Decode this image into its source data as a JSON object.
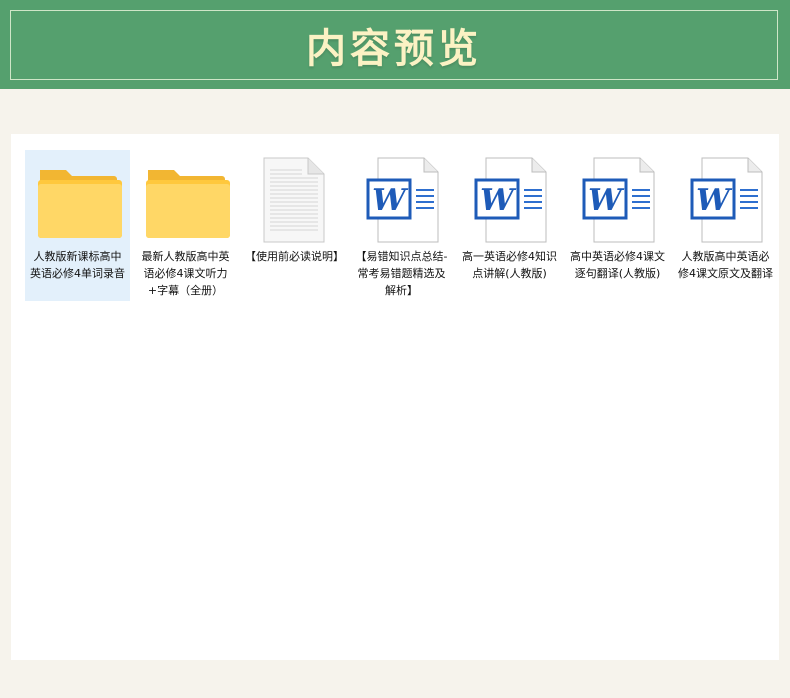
{
  "header": {
    "title": "内容预览"
  },
  "files": [
    {
      "type": "folder",
      "icon": "folder-icon",
      "name": "人教版新课标高中英语必修4单词录音",
      "selected": true
    },
    {
      "type": "folder",
      "icon": "folder-icon",
      "name": "最新人教版高中英语必修4课文听力+字幕（全册）",
      "selected": false
    },
    {
      "type": "text",
      "icon": "text-document-icon",
      "name": "【使用前必读说明】",
      "selected": false
    },
    {
      "type": "word",
      "icon": "word-document-icon",
      "name": "【易错知识点总结-常考易错题精选及解析】",
      "selected": false
    },
    {
      "type": "word",
      "icon": "word-document-icon",
      "name": "高一英语必修4知识点讲解(人教版)",
      "selected": false
    },
    {
      "type": "word",
      "icon": "word-document-icon",
      "name": "高中英语必修4课文逐句翻译(人教版)",
      "selected": false
    },
    {
      "type": "word",
      "icon": "word-document-icon",
      "name": "人教版高中英语必修4课文原文及翻译",
      "selected": false
    }
  ],
  "colors": {
    "banner": "#55a06e",
    "title": "#fbf2c4",
    "background": "#f6f3ec",
    "selection": "#e3f0fb",
    "word_blue": "#1e5bb8",
    "folder_yellow": "#ffc83d"
  }
}
